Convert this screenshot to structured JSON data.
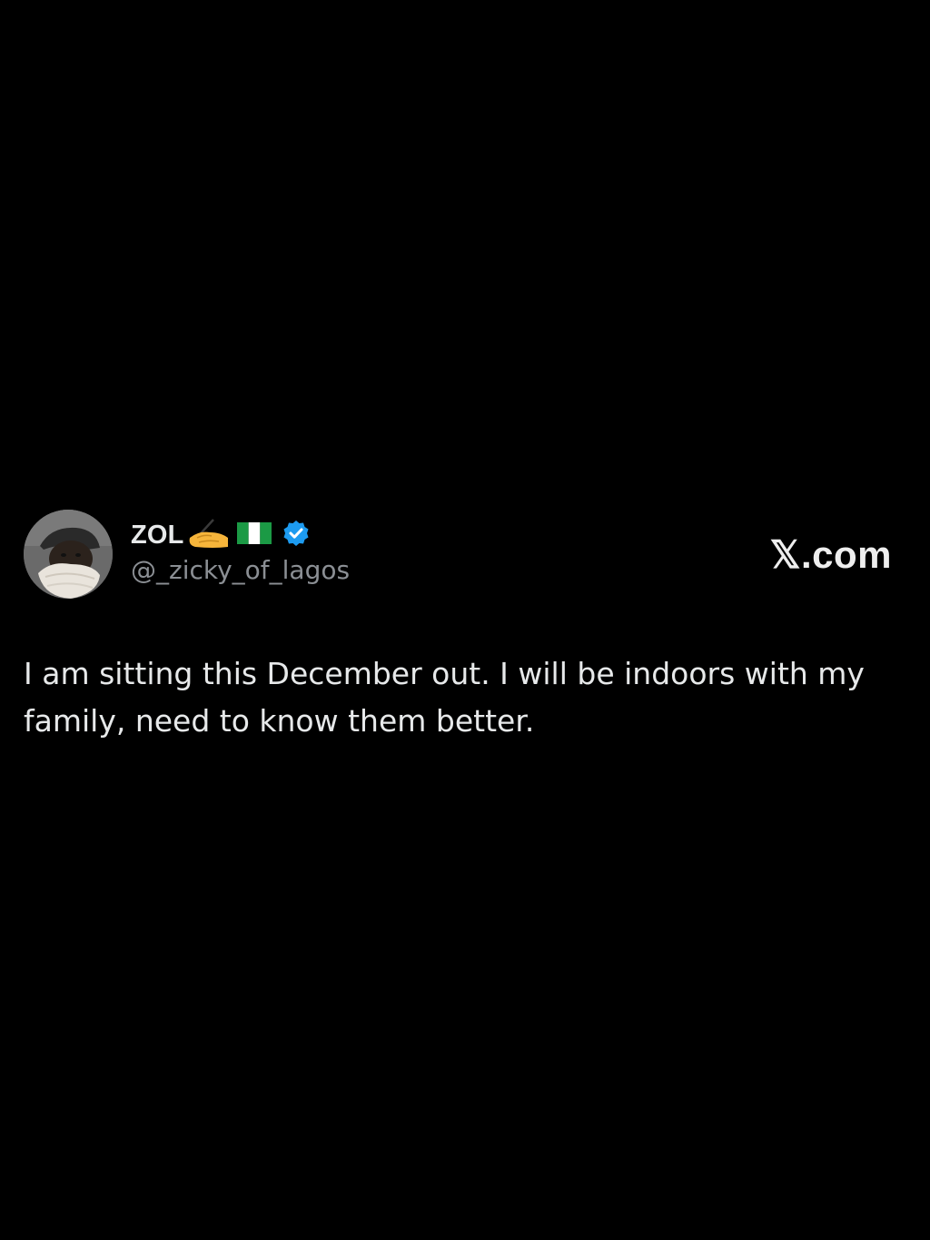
{
  "post": {
    "author": {
      "display_name": "ZOL",
      "name_emoji": "writing-hand",
      "name_flag": "nigeria-flag",
      "verified": true,
      "handle": "@_zicky_of_lagos"
    },
    "brand": "𝕏.com",
    "text": "I am sitting this December out. I will be indoors with my family, need to know them better."
  },
  "colors": {
    "background": "#000000",
    "text_primary": "#e7e9ea",
    "text_secondary": "#8b8f94",
    "verified_blue": "#1d9bf0"
  }
}
